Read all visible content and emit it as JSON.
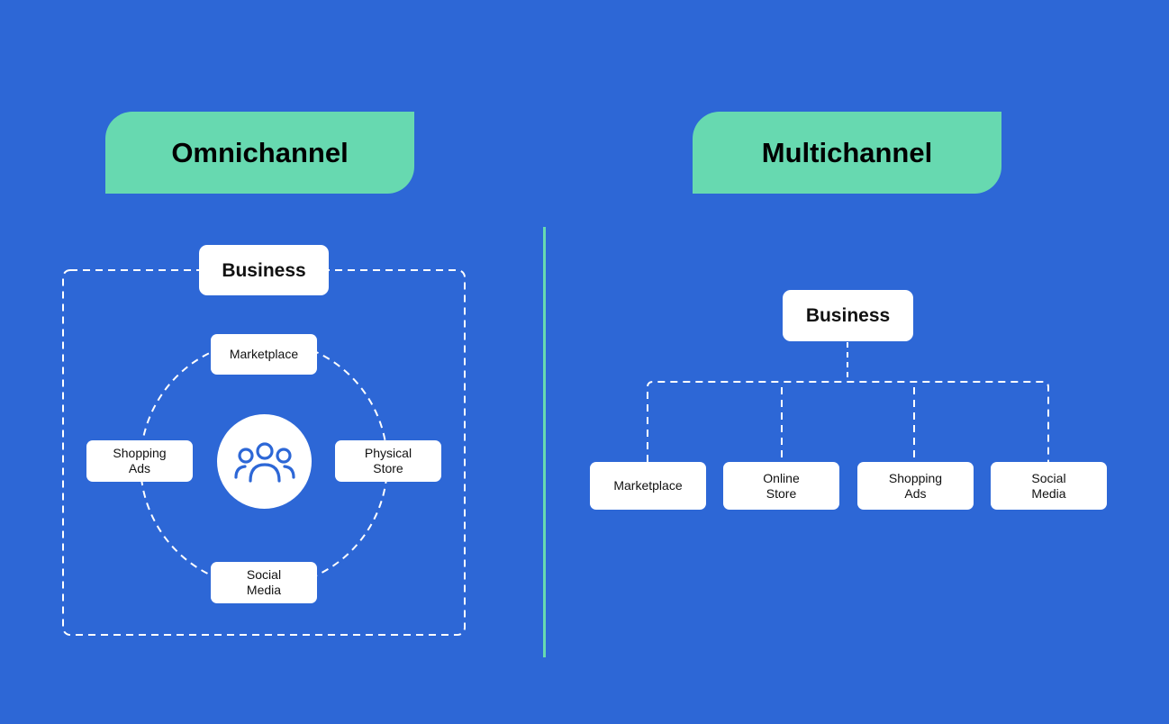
{
  "colors": {
    "background": "#2d67d6",
    "accent": "#67d9b0",
    "box": "#ffffff",
    "icon": "#2d67d6"
  },
  "omnichannel": {
    "title": "Omnichannel",
    "hub": "Business",
    "center_icon": "people-group-icon",
    "channels": {
      "top": "Marketplace",
      "left": "Shopping\nAds",
      "right": "Physical\nStore",
      "bottom": "Social\nMedia"
    }
  },
  "multichannel": {
    "title": "Multichannel",
    "hub": "Business",
    "channels": [
      "Marketplace",
      "Online\nStore",
      "Shopping\nAds",
      "Social\nMedia"
    ]
  }
}
